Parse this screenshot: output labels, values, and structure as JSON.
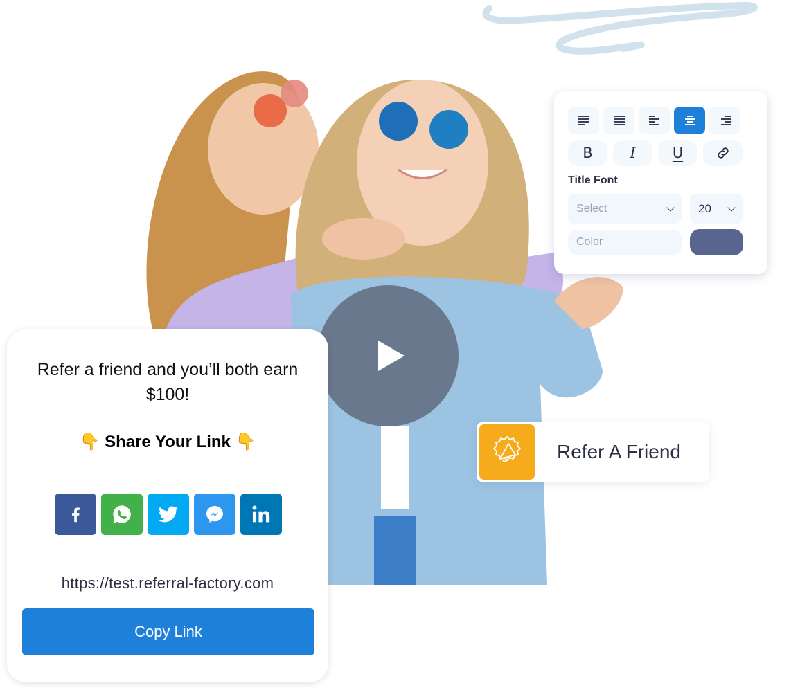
{
  "colors": {
    "accent_blue": "#1e80d9",
    "swatch_color": "#58658f",
    "badge_orange": "#f6ab1c",
    "swirl": "#d2e2ec",
    "facebook": "#3b5998",
    "whatsapp": "#43b149",
    "twitter": "#04a9f4",
    "messenger": "#2d96ee",
    "linkedin": "#0077b5"
  },
  "format_panel": {
    "alignment_buttons": [
      {
        "name": "align-left-justify",
        "icon": "align-left-icon",
        "active": false
      },
      {
        "name": "justify",
        "icon": "justify-icon",
        "active": false
      },
      {
        "name": "align-left",
        "icon": "align-left-short-icon",
        "active": false
      },
      {
        "name": "align-center",
        "icon": "align-center-icon",
        "active": true
      },
      {
        "name": "align-right",
        "icon": "align-right-icon",
        "active": false
      }
    ],
    "style_buttons": {
      "bold": "B",
      "italic": "I",
      "underline": "U",
      "link": "link-icon"
    },
    "title_font_label": "Title Font",
    "font_select_placeholder": "Select",
    "font_size_value": "20",
    "color_placeholder": "Color"
  },
  "video": {
    "play_icon": "play-icon"
  },
  "refer_badge": {
    "icon": "megaphone-icon",
    "label": "Refer A Friend"
  },
  "widget": {
    "headline": "Refer a friend and you’ll both earn $100!",
    "share_title": "Share Your Link",
    "share_emoji": "👇",
    "social_buttons": [
      {
        "name": "facebook",
        "icon": "facebook-icon"
      },
      {
        "name": "whatsapp",
        "icon": "whatsapp-icon"
      },
      {
        "name": "twitter",
        "icon": "twitter-icon"
      },
      {
        "name": "messenger",
        "icon": "messenger-icon"
      },
      {
        "name": "linkedin",
        "icon": "linkedin-icon"
      }
    ],
    "referral_link": "https://test.referral-factory.com",
    "copy_button_label": "Copy Link"
  }
}
